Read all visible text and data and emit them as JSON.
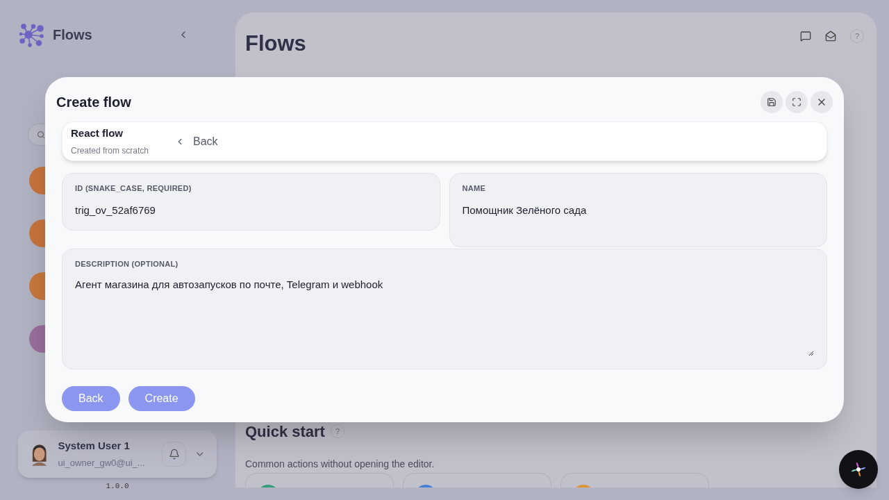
{
  "sidebar": {
    "brand": "Flows",
    "agents": [
      {
        "color": "#c8743c"
      },
      {
        "color": "#c8743c"
      },
      {
        "color": "#c8783c"
      },
      {
        "color": "#9a6f9e"
      }
    ],
    "user": {
      "name": "System User 1",
      "email": "ui_owner_gw0@ui_..."
    },
    "version": "1.0.0"
  },
  "main": {
    "title": "Flows",
    "help": "?",
    "quick_start": {
      "title": "Quick start",
      "help": "?",
      "subtitle": "Common actions without opening the editor.",
      "cards": [
        {
          "color": "#2f9e7a"
        },
        {
          "color": "#4a7fd6"
        },
        {
          "color": "#d9952e"
        }
      ]
    }
  },
  "dialog": {
    "title": "Create flow",
    "template": {
      "name": "React flow",
      "subtitle": "Created from scratch",
      "back": "Back"
    },
    "fields": [
      {
        "label": "ID (SNAKE_CASE, REQUIRED)",
        "value": "trig_ov_52af6769"
      },
      {
        "label": "NAME",
        "value": "Помощник Зелёного сада"
      }
    ],
    "description": {
      "label": "DESCRIPTION (OPTIONAL)",
      "value": "Агент магазина для автозапусков по почте, Telegram и webhook"
    },
    "buttons": [
      "Back",
      "Create"
    ]
  }
}
